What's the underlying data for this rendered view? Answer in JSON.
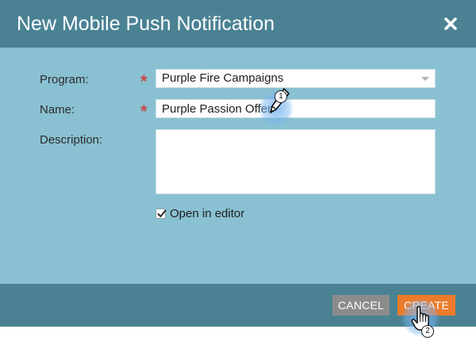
{
  "dialog": {
    "title": "New Mobile Push Notification",
    "close_icon": "close-x-icon"
  },
  "form": {
    "program": {
      "label": "Program:",
      "value": "Purple Fire Campaigns",
      "required_mark": "*"
    },
    "name": {
      "label": "Name:",
      "value": "Purple Passion Offer",
      "required_mark": "*"
    },
    "description": {
      "label": "Description:",
      "value": ""
    },
    "open_in_editor": {
      "label": "Open in editor",
      "checked": true
    }
  },
  "footer": {
    "cancel_label": "CANCEL",
    "create_label": "CREATE"
  },
  "annotations": {
    "step1": "1",
    "step2": "2"
  },
  "colors": {
    "header": "#4a8294",
    "body": "#89c1d2",
    "required": "#c84848",
    "cancel_button": "#8c8c8c",
    "create_button": "#ec7b2c"
  }
}
